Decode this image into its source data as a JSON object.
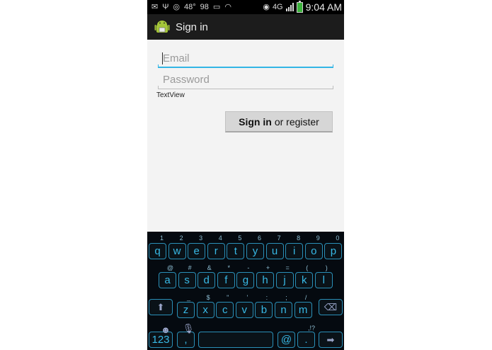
{
  "status_bar": {
    "temperature": "48°",
    "number": "98",
    "network": "4G",
    "time": "9:04 AM"
  },
  "action_bar": {
    "title": "Sign in"
  },
  "form": {
    "email_placeholder": "Email",
    "password_placeholder": "Password",
    "textview": "TextView",
    "button_bold": "Sign in",
    "button_rest": "or register"
  },
  "keyboard": {
    "number_hints": [
      "1",
      "2",
      "3",
      "4",
      "5",
      "6",
      "7",
      "8",
      "9",
      "0"
    ],
    "row1": [
      "q",
      "w",
      "e",
      "r",
      "t",
      "y",
      "u",
      "i",
      "o",
      "p"
    ],
    "row2_hints": [
      "@",
      "#",
      "&",
      "*",
      "-",
      "+",
      "=",
      "(",
      ")"
    ],
    "row2": [
      "a",
      "s",
      "d",
      "f",
      "g",
      "h",
      "j",
      "k",
      "l"
    ],
    "row3_hints": [
      "_",
      "$",
      "\"",
      "'",
      ":",
      ";",
      "/"
    ],
    "row3": [
      "z",
      "x",
      "c",
      "v",
      "b",
      "n",
      "m"
    ],
    "numbers_key": "123",
    "comma": ",",
    "at": "@",
    "period": ".",
    "period_hint": ",!?"
  },
  "icons": [
    "mail-icon",
    "usb-icon",
    "wifi-hotspot-icon",
    "voicemail-icon",
    "wifi-icon",
    "eye-icon",
    "signal-icon",
    "battery-icon",
    "android-app-icon",
    "shift-icon",
    "backspace-icon",
    "mic-icon",
    "emoji-icon",
    "enter-icon"
  ]
}
